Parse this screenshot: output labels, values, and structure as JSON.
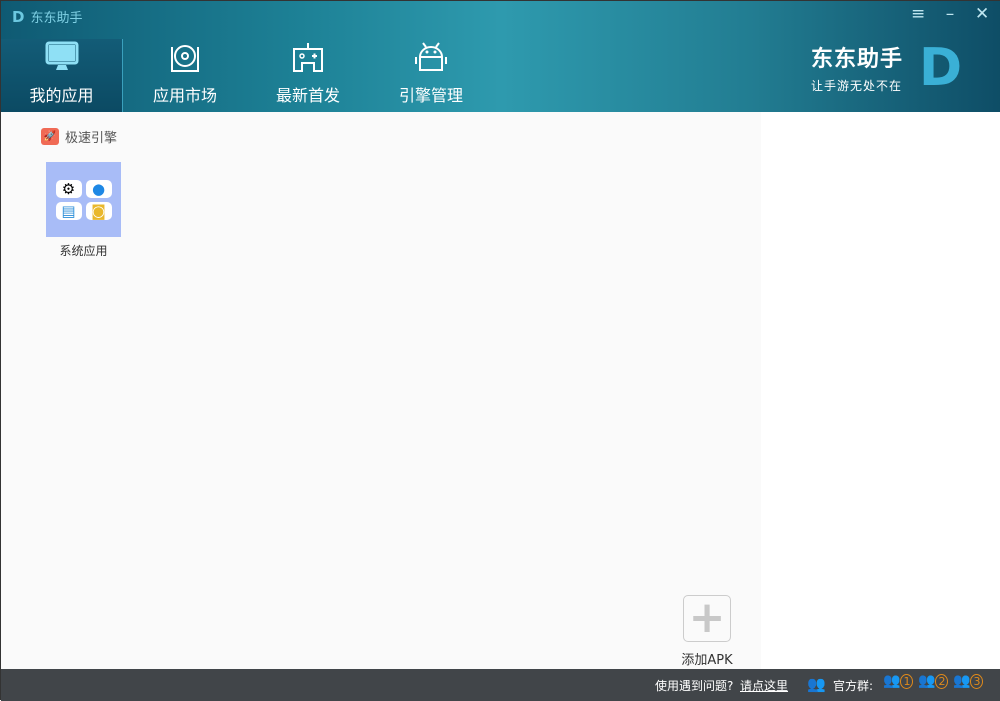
{
  "window": {
    "title": "东东助手",
    "logo": "D",
    "menu_icon": "≡",
    "minimize_icon": "–",
    "close_icon": "✕"
  },
  "tabs": [
    {
      "label": "我的应用",
      "icon": "monitor-icon"
    },
    {
      "label": "应用市场",
      "icon": "disc-icon"
    },
    {
      "label": "最新首发",
      "icon": "gamepad-icon"
    },
    {
      "label": "引擎管理",
      "icon": "android-icon"
    }
  ],
  "brand": {
    "name": "东东助手",
    "slogan": "让手游无处不在",
    "logo": "D"
  },
  "engine": {
    "label": "极速引擎"
  },
  "apps": [
    {
      "label": "系统应用"
    }
  ],
  "add_apk": {
    "icon": "+",
    "label": "添加APK"
  },
  "footer": {
    "question": "使用遇到问题?",
    "link": "请点这里",
    "group_label": "官方群:",
    "groups": [
      "1",
      "2",
      "3"
    ]
  }
}
